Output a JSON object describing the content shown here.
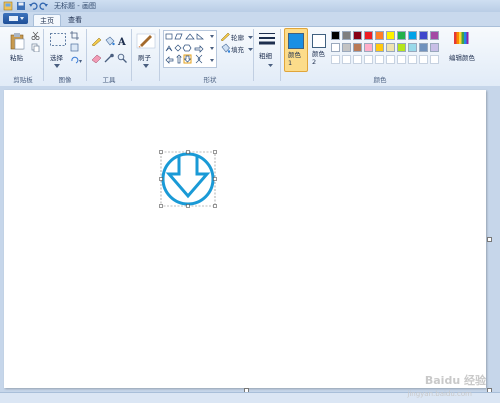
{
  "window": {
    "title": "无标题 - 画图"
  },
  "tabs": [
    {
      "label": "主页"
    },
    {
      "label": "查看"
    }
  ],
  "ribbon": {
    "clipboard": {
      "paste_label": "粘贴",
      "group_label": "剪贴板"
    },
    "image": {
      "select_label": "选择",
      "group_label": "图像"
    },
    "tools": {
      "group_label": "工具"
    },
    "brushes": {
      "label": "刷子"
    },
    "shapes": {
      "outline_label": "轮廓",
      "fill_label": "填充",
      "group_label": "形状"
    },
    "size": {
      "label": "粗细"
    },
    "colors": {
      "color1_label": "颜色 1",
      "color2_label": "颜色 2",
      "edit_label": "编辑颜色",
      "group_label": "颜色",
      "color1_value": "#1a8fe3",
      "color2_value": "#ffffff",
      "palette_row1": [
        "#000000",
        "#7f7f7f",
        "#880015",
        "#ed1c24",
        "#ff7f27",
        "#fff200",
        "#22b14c",
        "#00a2e8",
        "#3f48cc",
        "#a349a4"
      ],
      "palette_row2": [
        "#ffffff",
        "#c3c3c3",
        "#b97a57",
        "#ffaec9",
        "#ffc90e",
        "#efe4b0",
        "#b5e61d",
        "#99d9ea",
        "#7092be",
        "#c8bfe7"
      ]
    }
  },
  "canvas": {
    "shape_stroke_color": "#1a9ad6"
  },
  "watermark": {
    "text": "Baidu 经验",
    "sub": "jingyan.baidu.com"
  }
}
